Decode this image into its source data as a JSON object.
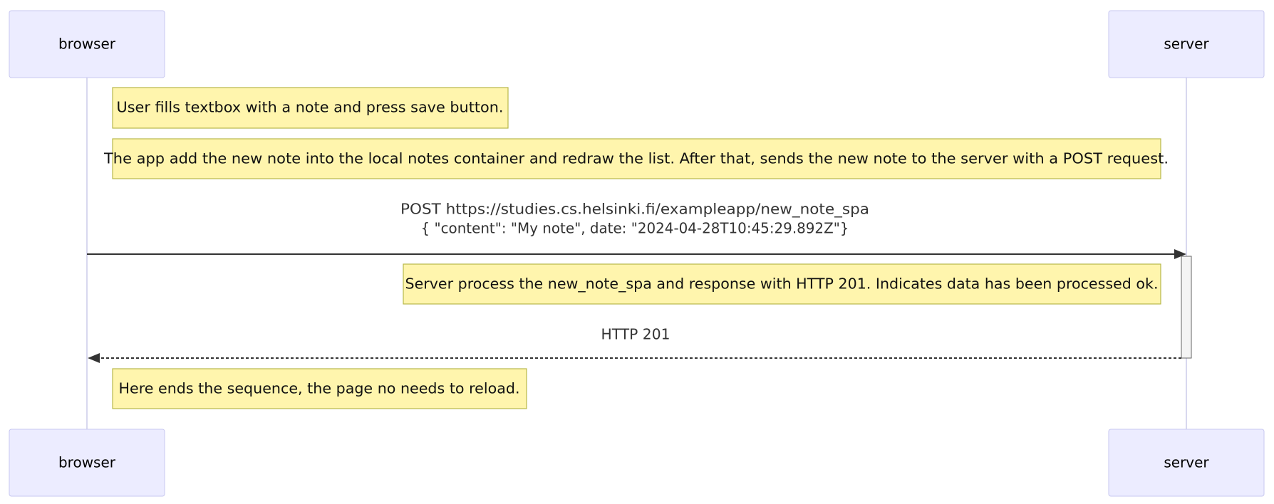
{
  "participants": {
    "browser": "browser",
    "server": "server"
  },
  "notes": {
    "user_fills": "User fills textbox with a note and press save button.",
    "app_adds": "The app add the new note into the local notes container and redraw the list. After that, sends the new note to the server with a POST request.",
    "server_process": "Server process the new_note_spa and response with HTTP 201. Indicates data has been processed ok.",
    "sequence_ends": "Here ends the sequence, the page no needs to reload."
  },
  "messages": {
    "post_request": {
      "line1": "POST https://studies.cs.helsinki.fi/exampleapp/new_note_spa",
      "line2": "{ \"content\": \"My note\", date: \"2024-04-28T10:45:29.892Z\"}",
      "from": "browser",
      "to": "server",
      "style": "solid"
    },
    "http_response": {
      "line1": "HTTP 201",
      "from": "server",
      "to": "browser",
      "style": "dashed"
    }
  },
  "colors": {
    "actor_fill": "#ececff",
    "actor_stroke": "#c7c7f0",
    "note_fill": "#fff5ad",
    "note_stroke": "#b8b84a",
    "line": "#333333"
  }
}
